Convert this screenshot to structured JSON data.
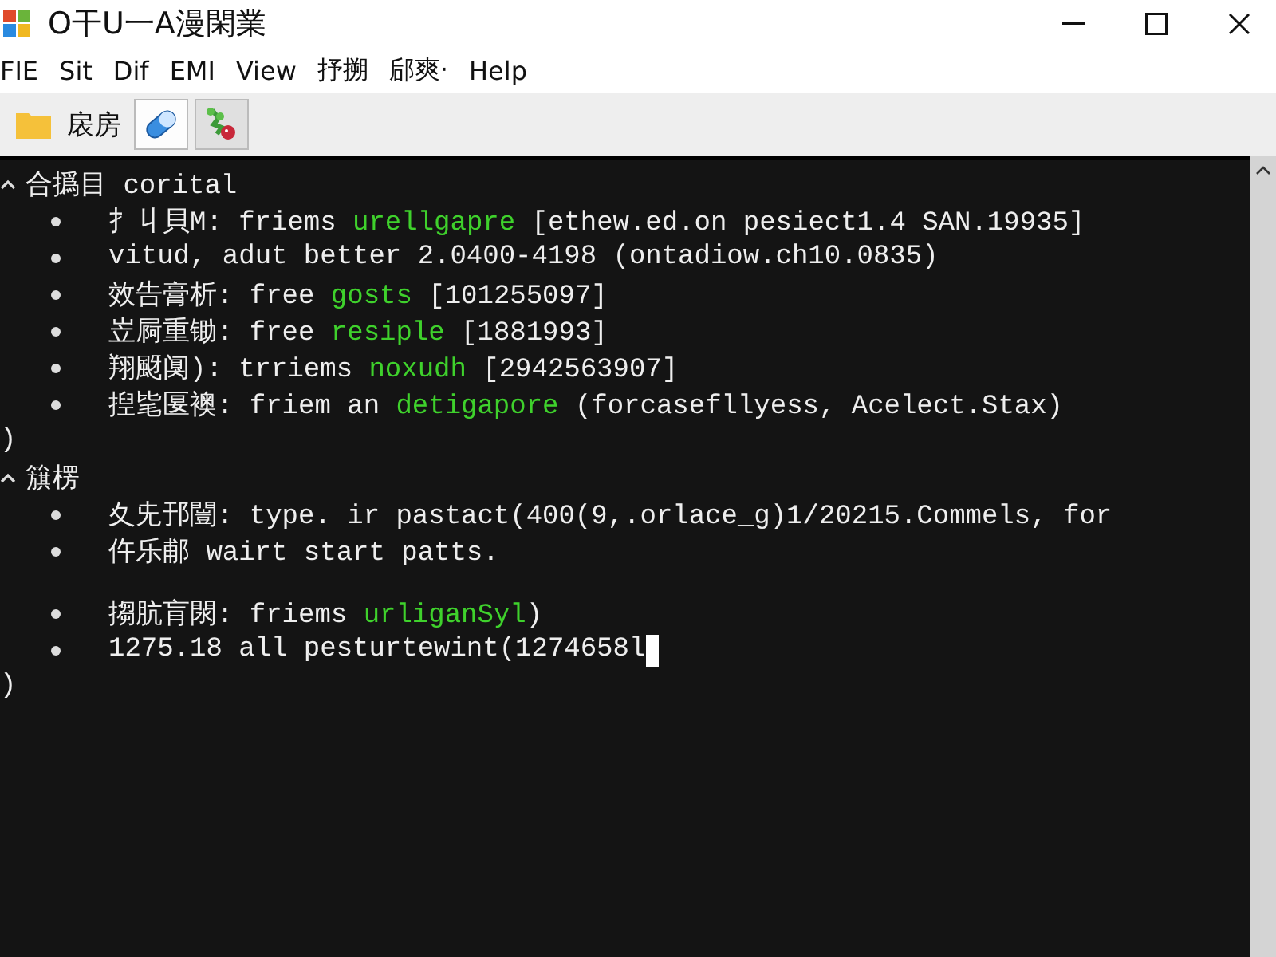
{
  "window": {
    "title": "O干U一A漫閑業"
  },
  "menu": [
    "FIE",
    "Sit",
    "Dif",
    "EMI",
    "View",
    "抒搠",
    "郈爽·",
    "Help"
  ],
  "toolbar": {
    "label": "扆房",
    "buttons": [
      {
        "kind": "pill",
        "pressed": true
      },
      {
        "kind": "plant",
        "pressed": false
      }
    ]
  },
  "terminal": {
    "groups": [
      {
        "label": "合撝目 corital",
        "expanded": true,
        "closer": ")",
        "items": [
          {
            "kind": "line",
            "parts": [
              {
                "text": "扌丩貝M: friems ",
                "green": false
              },
              {
                "text": "urellgapre",
                "green": true
              },
              {
                "text": " [ethew.ed.on pesiect1.4 SAN.19935]",
                "green": false
              }
            ]
          },
          {
            "kind": "line",
            "parts": [
              {
                "text": "vitud, adut better 2.0400-4198 (ontadiow.ch10.0835)",
                "green": false
              }
            ]
          },
          {
            "kind": "line",
            "parts": [
              {
                "text": "效告膏析: free ",
                "green": false
              },
              {
                "text": "gosts",
                "green": true
              },
              {
                "text": " [101255097]",
                "green": false
              }
            ]
          },
          {
            "kind": "line",
            "parts": [
              {
                "text": "岦屙重锄: free ",
                "green": false
              },
              {
                "text": "resiple",
                "green": true
              },
              {
                "text": " [1881993]",
                "green": false
              }
            ]
          },
          {
            "kind": "line",
            "parts": [
              {
                "text": "翔颬阒): trriems ",
                "green": false
              },
              {
                "text": "noxudh",
                "green": true
              },
              {
                "text": " [2942563907]",
                "green": false
              }
            ]
          },
          {
            "kind": "line",
            "parts": [
              {
                "text": "揑毞匽襖: friem an ",
                "green": false
              },
              {
                "text": "detigapore",
                "green": true
              },
              {
                "text": " (forcasefllyess, Acelect.Stax)",
                "green": false
              }
            ]
          }
        ]
      },
      {
        "label": "簱楞",
        "expanded": true,
        "closer": ")",
        "items": [
          {
            "kind": "line",
            "parts": [
              {
                "text": "夊兂邘闓: type. ir pastact(400(9,.orlace_g)1/20215.Commels, for",
                "green": false
              }
            ]
          },
          {
            "kind": "line",
            "parts": [
              {
                "text": "仵乐郙 wairt start patts.",
                "green": false
              }
            ]
          },
          {
            "kind": "gap"
          },
          {
            "kind": "line",
            "parts": [
              {
                "text": "搊肮肓閖: friems ",
                "green": false
              },
              {
                "text": "urliganSyl",
                "green": true
              },
              {
                "text": ")",
                "green": false
              }
            ]
          },
          {
            "kind": "line",
            "cursor": true,
            "parts": [
              {
                "text": "1275.18 all pesturtewint(1274658l",
                "green": false
              }
            ]
          }
        ]
      }
    ]
  }
}
